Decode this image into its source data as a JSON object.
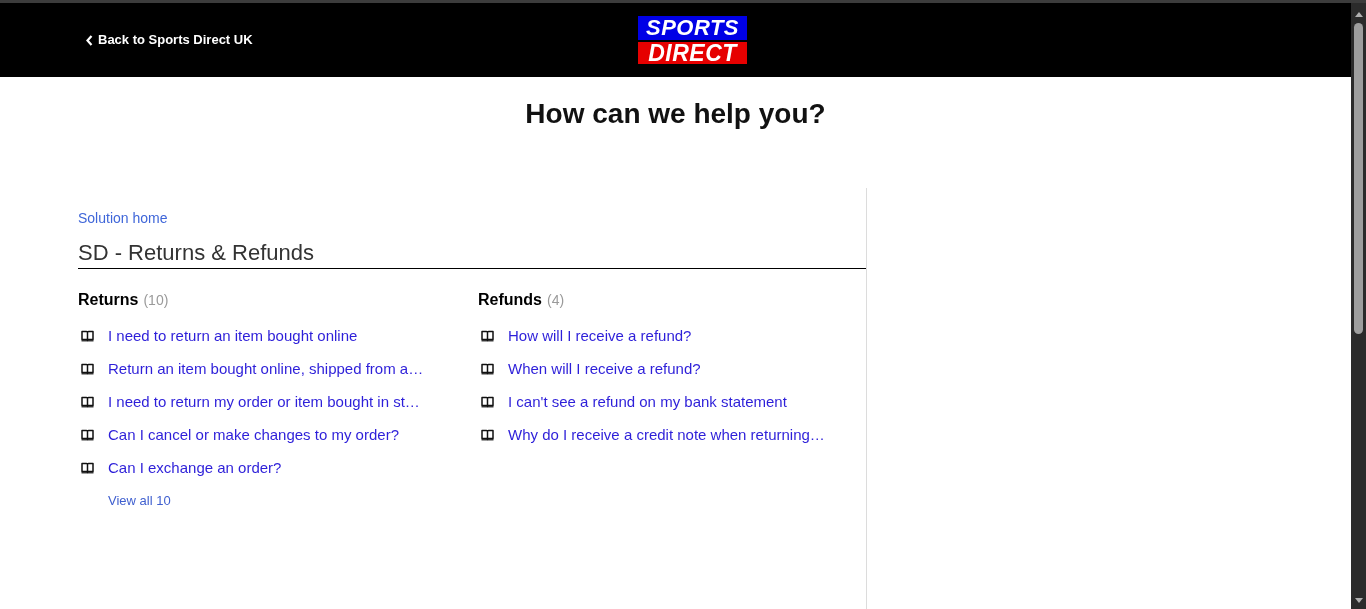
{
  "header": {
    "back_link": "Back to Sports Direct UK",
    "logo": {
      "line_1": "SPORTS",
      "line_2": "DIRECT"
    }
  },
  "page_title": "How can we help you?",
  "breadcrumb": "Solution home",
  "folder_title": "SD - Returns & Refunds",
  "categories": [
    {
      "title": "Returns",
      "count": "(10)",
      "articles": [
        "I need to return an item bought online",
        "Return an item bought online, shipped from a…",
        "I need to return my order or item bought in st…",
        "Can I cancel or make changes to my order?",
        "Can I exchange an order?"
      ],
      "view_all": "View all 10"
    },
    {
      "title": "Refunds",
      "count": "(4)",
      "articles": [
        "How will I receive a refund?",
        "When will I receive a refund?",
        "I can't see a refund on my bank statement",
        "Why do I receive a credit note when returning…"
      ]
    }
  ]
}
